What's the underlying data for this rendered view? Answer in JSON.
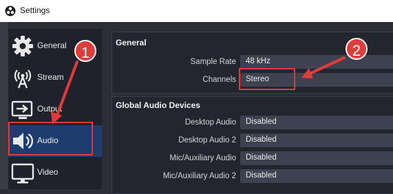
{
  "window": {
    "title": "Settings"
  },
  "sidebar": {
    "items": [
      {
        "label": "General",
        "icon": "gear-icon"
      },
      {
        "label": "Stream",
        "icon": "broadcast-icon"
      },
      {
        "label": "Output",
        "icon": "output-icon"
      },
      {
        "label": "Audio",
        "icon": "speaker-icon",
        "selected": true
      },
      {
        "label": "Video",
        "icon": "monitor-icon"
      }
    ]
  },
  "general": {
    "title": "General",
    "sample_rate": {
      "label": "Sample Rate",
      "value": "48 kHz"
    },
    "channels": {
      "label": "Channels",
      "value": "Stereo"
    }
  },
  "devices": {
    "title": "Global Audio Devices",
    "rows": [
      {
        "label": "Desktop Audio",
        "value": "Disabled"
      },
      {
        "label": "Desktop Audio 2",
        "value": "Disabled"
      },
      {
        "label": "Mic/Auxiliary Audio",
        "value": "Disabled"
      },
      {
        "label": "Mic/Auxiliary Audio 2",
        "value": "Disabled"
      }
    ]
  },
  "annotations": {
    "step1": "1",
    "step2": "2",
    "color": "#e23a3a"
  }
}
